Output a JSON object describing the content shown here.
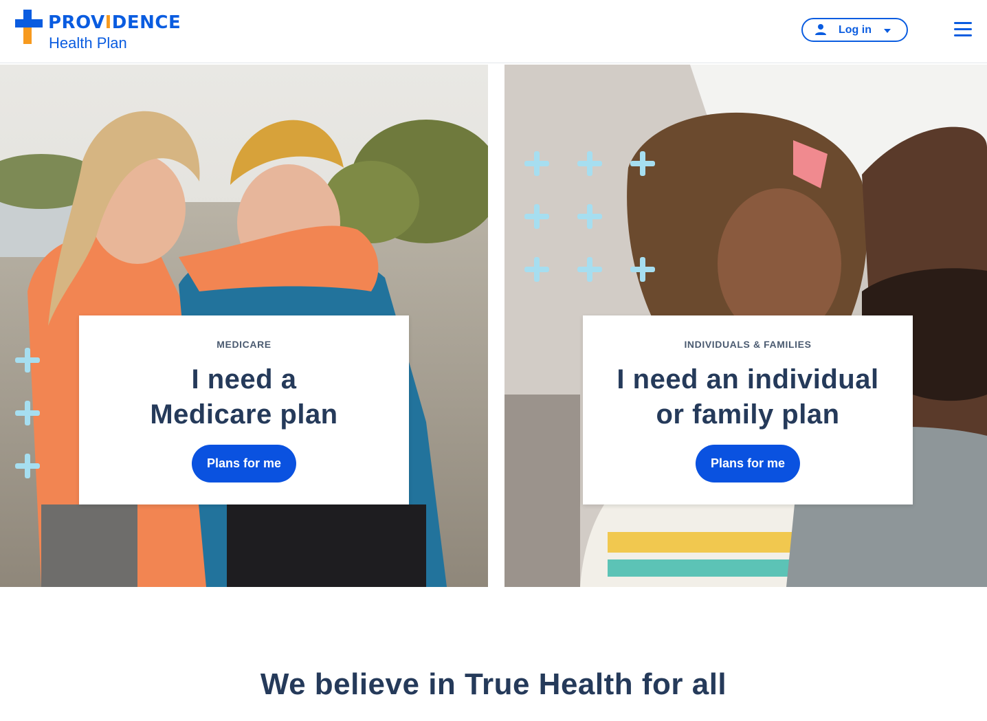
{
  "brand": {
    "name": "PROVIDENCE",
    "name_prefix": "PROV",
    "name_accent": "I",
    "name_suffix": "DENCE",
    "subtitle": "Health Plan",
    "primary_color": "#0a5ce0",
    "accent_color": "#f79a1e"
  },
  "header": {
    "login_label": "Log in",
    "login_icon": "user-icon",
    "login_dropdown_icon": "caret-down-icon",
    "menu_icon": "hamburger-menu-icon"
  },
  "hero": {
    "panels": [
      {
        "eyebrow": "MEDICARE",
        "headline_line1": "I need a",
        "headline_line2": "Medicare plan",
        "cta_label": "Plans for me",
        "image_description": "two women laughing on a beach"
      },
      {
        "eyebrow": "INDIVIDUALS & FAMILIES",
        "headline_line1": "I need an individual",
        "headline_line2": "or family plan",
        "cta_label": "Plans for me",
        "image_description": "father and daughter touching foreheads"
      }
    ],
    "decoration_icon": "plus-icon",
    "decoration_color": "#a6def0",
    "cta_color": "#0a52e0"
  },
  "tagline": "We believe in True Health for all"
}
